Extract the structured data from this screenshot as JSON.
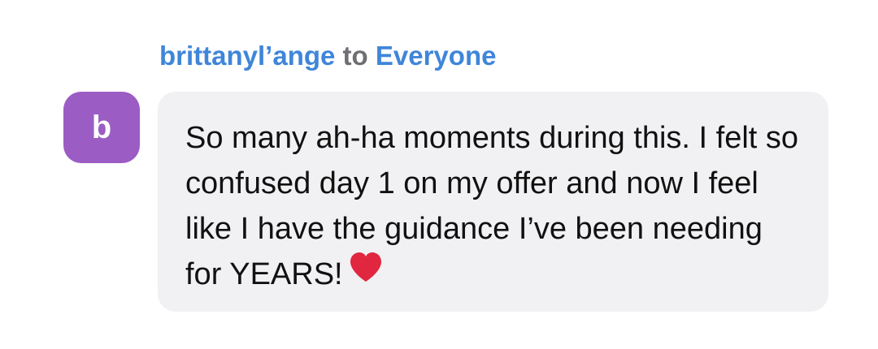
{
  "message": {
    "sender": "brittanyl’ange",
    "connector": "to",
    "recipient": "Everyone",
    "avatar_letter": "b",
    "text": "So many ah-ha moments during this. I felt so confused day 1 on my offer and now I feel like I have the guidance I’ve been needing for YEARS!",
    "emoji": "heart-icon"
  },
  "colors": {
    "sender_name": "#3f86d9",
    "connector": "#6e6e73",
    "avatar_bg": "#9b5cc4",
    "bubble_bg": "#f1f1f3",
    "heart": "#e0273f"
  }
}
